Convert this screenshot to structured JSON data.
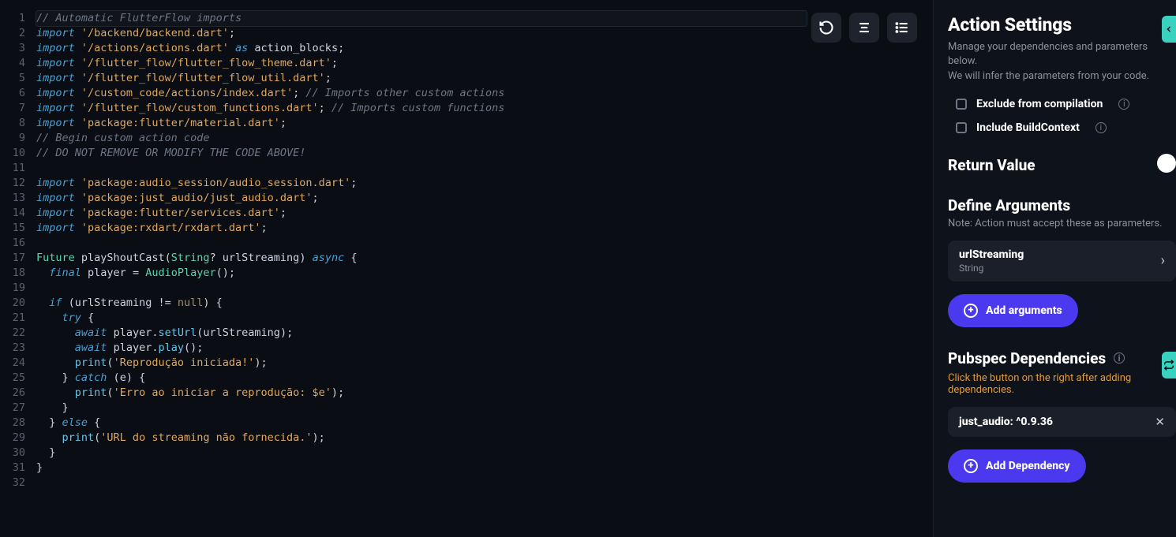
{
  "editor": {
    "lines": [
      [
        [
          "comment",
          "// Automatic FlutterFlow imports"
        ]
      ],
      [
        [
          "keyword",
          "import"
        ],
        [
          "punct",
          " "
        ],
        [
          "string",
          "'/backend/backend.dart'"
        ],
        [
          "punct",
          ";"
        ]
      ],
      [
        [
          "keyword",
          "import"
        ],
        [
          "punct",
          " "
        ],
        [
          "string",
          "'/actions/actions.dart'"
        ],
        [
          "punct",
          " "
        ],
        [
          "keyword",
          "as"
        ],
        [
          "punct",
          " "
        ],
        [
          "ident",
          "action_blocks"
        ],
        [
          "punct",
          ";"
        ]
      ],
      [
        [
          "keyword",
          "import"
        ],
        [
          "punct",
          " "
        ],
        [
          "string",
          "'/flutter_flow/flutter_flow_theme.dart'"
        ],
        [
          "punct",
          ";"
        ]
      ],
      [
        [
          "keyword",
          "import"
        ],
        [
          "punct",
          " "
        ],
        [
          "string",
          "'/flutter_flow/flutter_flow_util.dart'"
        ],
        [
          "punct",
          ";"
        ]
      ],
      [
        [
          "keyword",
          "import"
        ],
        [
          "punct",
          " "
        ],
        [
          "string",
          "'/custom_code/actions/index.dart'"
        ],
        [
          "punct",
          "; "
        ],
        [
          "comment",
          "// Imports other custom actions"
        ]
      ],
      [
        [
          "keyword",
          "import"
        ],
        [
          "punct",
          " "
        ],
        [
          "string",
          "'/flutter_flow/custom_functions.dart'"
        ],
        [
          "punct",
          "; "
        ],
        [
          "comment",
          "// Imports custom functions"
        ]
      ],
      [
        [
          "keyword",
          "import"
        ],
        [
          "punct",
          " "
        ],
        [
          "string",
          "'package:flutter/material.dart'"
        ],
        [
          "punct",
          ";"
        ]
      ],
      [
        [
          "comment",
          "// Begin custom action code"
        ]
      ],
      [
        [
          "comment",
          "// DO NOT REMOVE OR MODIFY THE CODE ABOVE!"
        ]
      ],
      [],
      [
        [
          "keyword",
          "import"
        ],
        [
          "punct",
          " "
        ],
        [
          "string",
          "'package:audio_session/audio_session.dart'"
        ],
        [
          "punct",
          ";"
        ]
      ],
      [
        [
          "keyword",
          "import"
        ],
        [
          "punct",
          " "
        ],
        [
          "string",
          "'package:just_audio/just_audio.dart'"
        ],
        [
          "punct",
          ";"
        ]
      ],
      [
        [
          "keyword",
          "import"
        ],
        [
          "punct",
          " "
        ],
        [
          "string",
          "'package:flutter/services.dart'"
        ],
        [
          "punct",
          ";"
        ]
      ],
      [
        [
          "keyword",
          "import"
        ],
        [
          "punct",
          " "
        ],
        [
          "string",
          "'package:rxdart/rxdart.dart'"
        ],
        [
          "punct",
          ";"
        ]
      ],
      [],
      [
        [
          "type",
          "Future"
        ],
        [
          "punct",
          " "
        ],
        [
          "ident",
          "playShoutCast"
        ],
        [
          "punct",
          "("
        ],
        [
          "type",
          "String"
        ],
        [
          "punct",
          "? "
        ],
        [
          "ident",
          "urlStreaming"
        ],
        [
          "punct",
          ") "
        ],
        [
          "keyword",
          "async"
        ],
        [
          "punct",
          " {"
        ]
      ],
      [
        [
          "punct",
          "  "
        ],
        [
          "keyword",
          "final"
        ],
        [
          "punct",
          " "
        ],
        [
          "ident",
          "player"
        ],
        [
          "punct",
          " = "
        ],
        [
          "type",
          "AudioPlayer"
        ],
        [
          "punct",
          "();"
        ]
      ],
      [],
      [
        [
          "punct",
          "  "
        ],
        [
          "keyword",
          "if"
        ],
        [
          "punct",
          " ("
        ],
        [
          "ident",
          "urlStreaming"
        ],
        [
          "punct",
          " != "
        ],
        [
          "null",
          "null"
        ],
        [
          "punct",
          ") {"
        ]
      ],
      [
        [
          "punct",
          "    "
        ],
        [
          "keyword",
          "try"
        ],
        [
          "punct",
          " {"
        ]
      ],
      [
        [
          "punct",
          "      "
        ],
        [
          "keyword",
          "await"
        ],
        [
          "punct",
          " "
        ],
        [
          "ident",
          "player"
        ],
        [
          "punct",
          "."
        ],
        [
          "func",
          "setUrl"
        ],
        [
          "punct",
          "("
        ],
        [
          "ident",
          "urlStreaming"
        ],
        [
          "punct",
          ");"
        ]
      ],
      [
        [
          "punct",
          "      "
        ],
        [
          "keyword",
          "await"
        ],
        [
          "punct",
          " "
        ],
        [
          "ident",
          "player"
        ],
        [
          "punct",
          "."
        ],
        [
          "func",
          "play"
        ],
        [
          "punct",
          "();"
        ]
      ],
      [
        [
          "punct",
          "      "
        ],
        [
          "func",
          "print"
        ],
        [
          "punct",
          "("
        ],
        [
          "string",
          "'Reprodução iniciada!'"
        ],
        [
          "punct",
          ");"
        ]
      ],
      [
        [
          "punct",
          "    } "
        ],
        [
          "keyword",
          "catch"
        ],
        [
          "punct",
          " ("
        ],
        [
          "ident",
          "e"
        ],
        [
          "punct",
          ") {"
        ]
      ],
      [
        [
          "punct",
          "      "
        ],
        [
          "func",
          "print"
        ],
        [
          "punct",
          "("
        ],
        [
          "string",
          "'Erro ao iniciar a reprodução: $e'"
        ],
        [
          "punct",
          ");"
        ]
      ],
      [
        [
          "punct",
          "    }"
        ]
      ],
      [
        [
          "punct",
          "  } "
        ],
        [
          "keyword",
          "else"
        ],
        [
          "punct",
          " {"
        ]
      ],
      [
        [
          "punct",
          "    "
        ],
        [
          "func",
          "print"
        ],
        [
          "punct",
          "("
        ],
        [
          "string",
          "'URL do streaming não fornecida.'"
        ],
        [
          "punct",
          ");"
        ]
      ],
      [
        [
          "punct",
          "  }"
        ]
      ],
      [
        [
          "punct",
          "}"
        ]
      ],
      []
    ],
    "lineCount": 32,
    "highlightedLine": 1
  },
  "sidebar": {
    "title": "Action Settings",
    "subtitle1": "Manage your dependencies and parameters below.",
    "subtitle2": "We will infer the parameters from your code.",
    "excludeLabel": "Exclude from compilation",
    "includeLabel": "Include BuildContext",
    "returnValue": "Return Value",
    "defineArgs": "Define Arguments",
    "defineArgsNote": "Note: Action must accept these as parameters.",
    "argument": {
      "name": "urlStreaming",
      "type": "String"
    },
    "addArgs": "Add arguments",
    "pubspec": "Pubspec Dependencies",
    "pubspecWarn": "Click the button on the right after adding dependencies.",
    "dependency": "just_audio: ^0.9.36",
    "addDep": "Add Dependency"
  }
}
